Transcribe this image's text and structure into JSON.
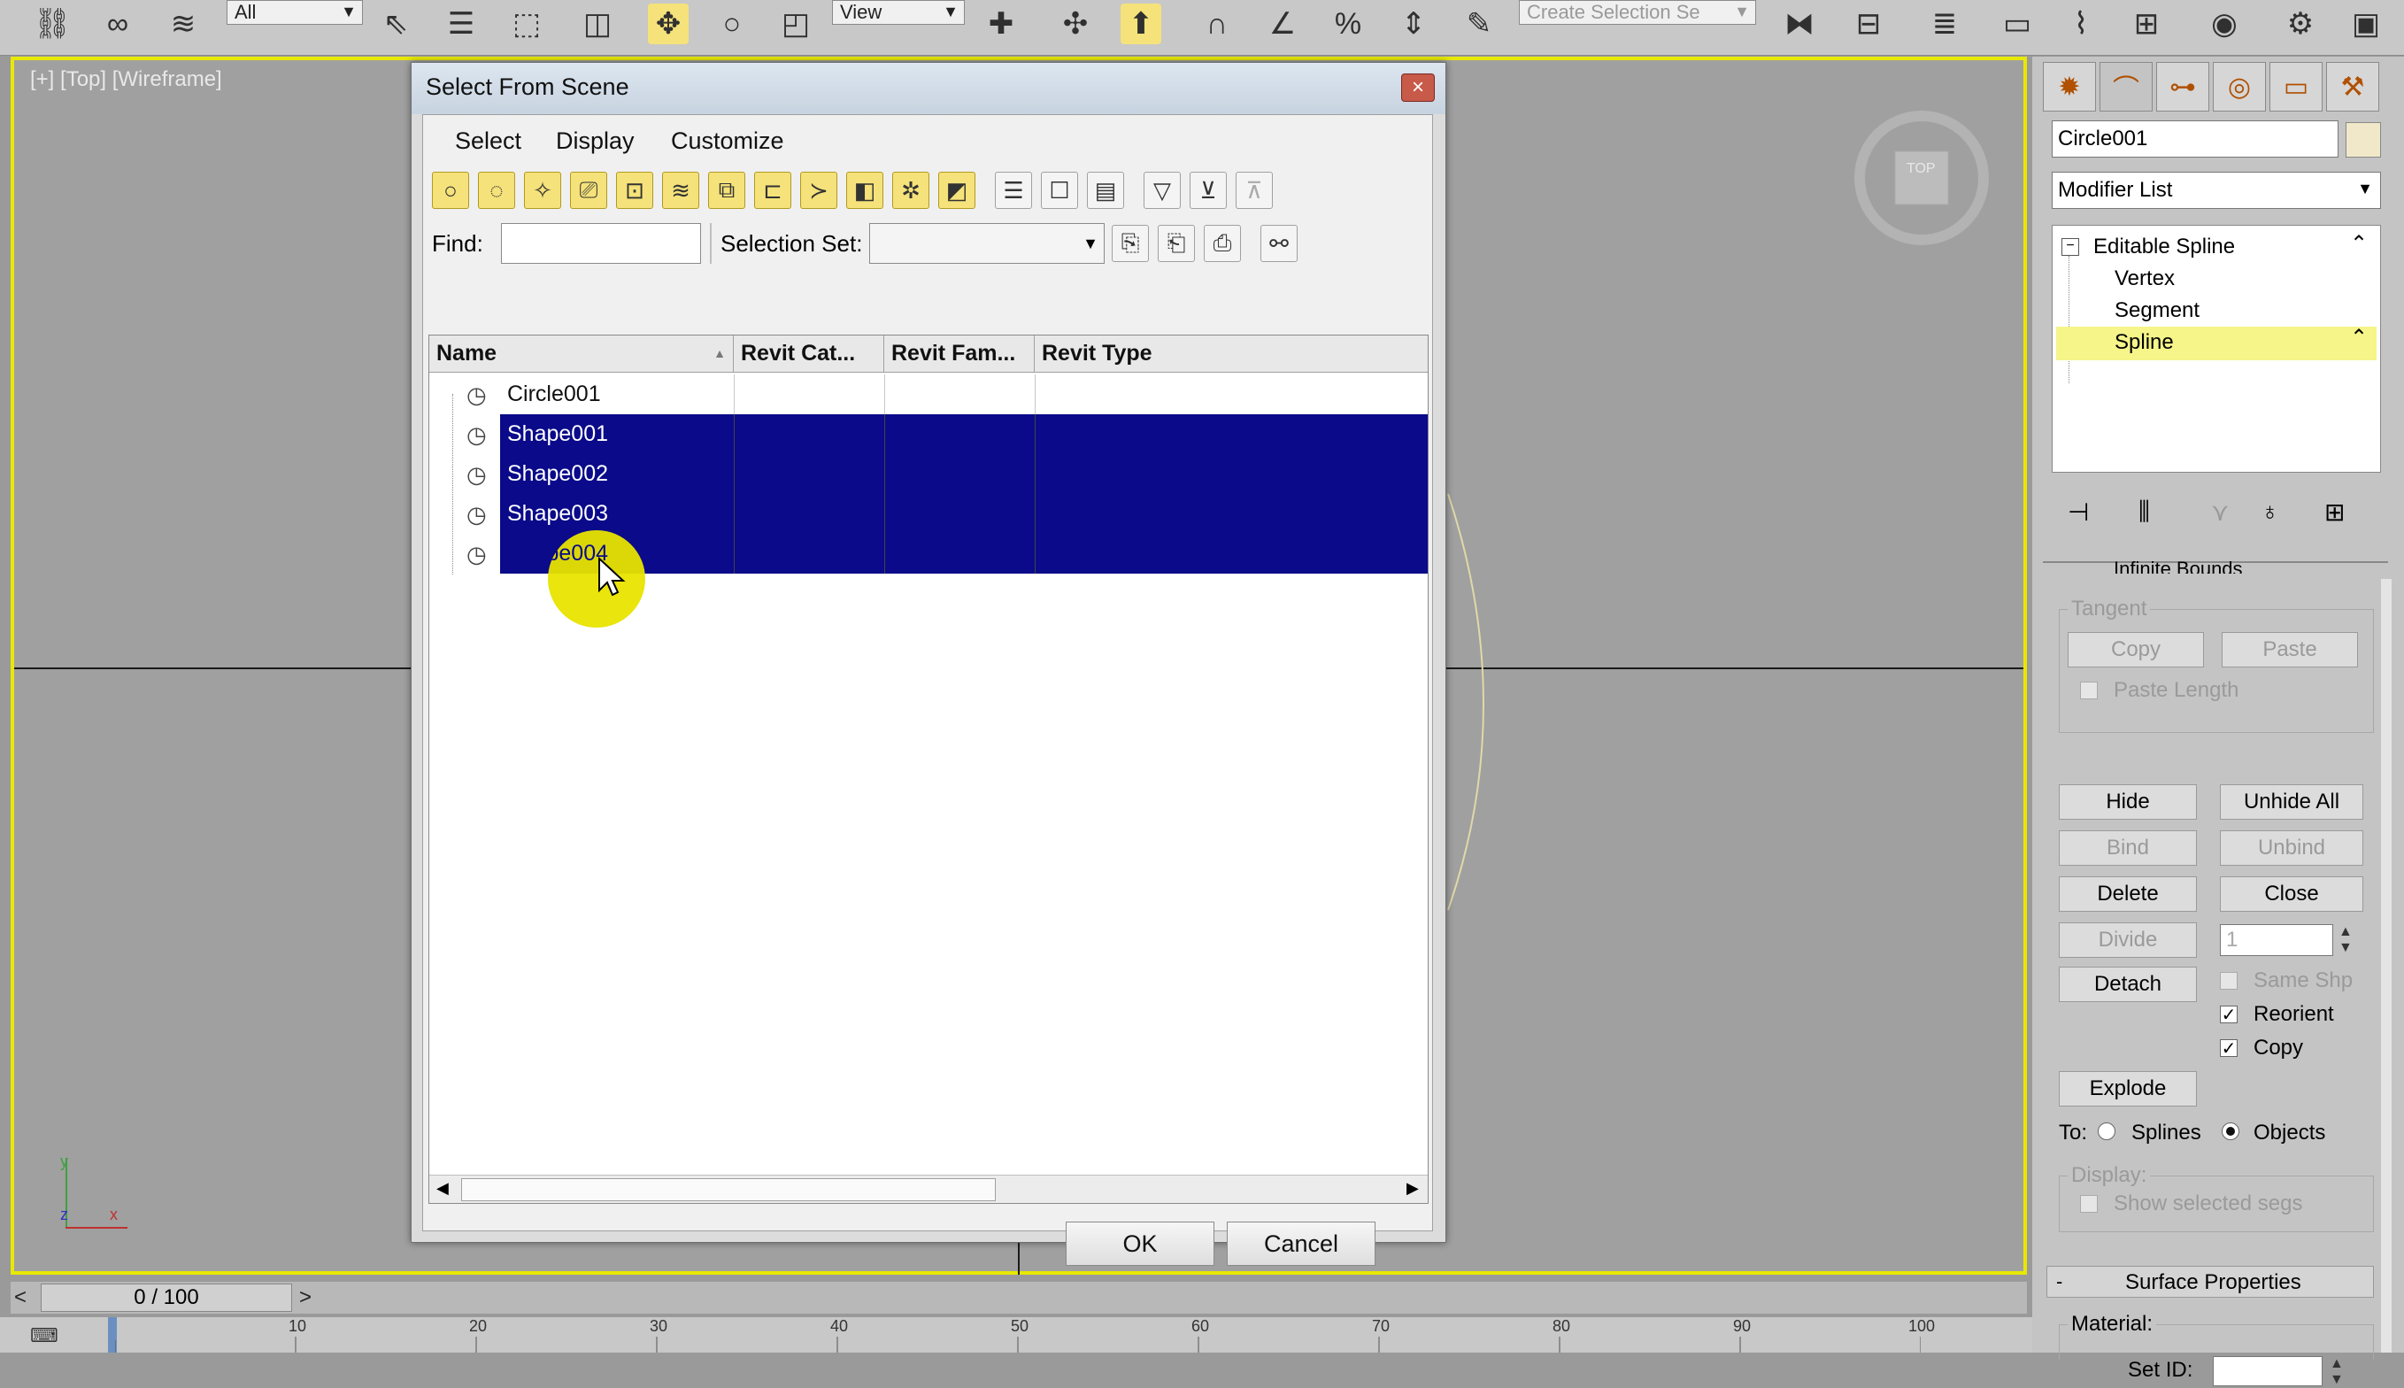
{
  "toolbar": {
    "filter_value": "All",
    "reference_coord_value": "View",
    "named_selection_placeholder": "Create Selection Se"
  },
  "viewport": {
    "label": "[+] [Top] [Wireframe]",
    "viewcube_label": "TOP",
    "axis_y": "y",
    "axis_x": "x",
    "axis_z": "z"
  },
  "timeline": {
    "prev": "<",
    "frame_display": "0 / 100",
    "next": ">"
  },
  "dialog": {
    "title": "Select From Scene",
    "close": "×",
    "menu": [
      "Select",
      "Display",
      "Customize"
    ],
    "find_label": "Find:",
    "find_value": "",
    "selection_set_label": "Selection Set:",
    "selection_set_value": "",
    "columns": [
      "Name",
      "Revit Cat...",
      "Revit Fam...",
      "Revit Type"
    ],
    "sort_indicator": "▲",
    "rows": [
      {
        "name": "Circle001",
        "selected": false
      },
      {
        "name": "Shape001",
        "selected": true
      },
      {
        "name": "Shape002",
        "selected": true
      },
      {
        "name": "Shape003",
        "selected": true
      },
      {
        "name": "Shape004",
        "selected": true
      }
    ],
    "ok_label": "OK",
    "cancel_label": "Cancel"
  },
  "command_panel": {
    "object_name": "Circle001",
    "modifier_list_label": "Modifier List",
    "stack": {
      "root": "Editable Spline",
      "subs": [
        "Vertex",
        "Segment",
        "Spline"
      ],
      "active": "Spline"
    },
    "infinite_bounds_label": "Infinite Bounds",
    "tangent_group": "Tangent",
    "copy_label": "Copy",
    "paste_label": "Paste",
    "paste_length_label": "Paste Length",
    "hide_label": "Hide",
    "unhide_all_label": "Unhide All",
    "bind_label": "Bind",
    "unbind_label": "Unbind",
    "delete_label": "Delete",
    "close_label": "Close",
    "divide_label": "Divide",
    "divide_value": "1",
    "same_shp_label": "Same Shp",
    "detach_label": "Detach",
    "reorient_label": "Reorient",
    "copy_cb_label": "Copy",
    "explode_label": "Explode",
    "to_label": "To:",
    "splines_label": "Splines",
    "objects_label": "Objects",
    "display_group": "Display:",
    "show_selected_segs_label": "Show selected segs",
    "surface_properties_label": "Surface Properties",
    "surface_collapse": "-",
    "material_label": "Material:",
    "set_id_label": "Set ID:",
    "set_id_value": ""
  },
  "ruler_ticks": [
    "10",
    "20",
    "30",
    "40",
    "50",
    "60",
    "70",
    "80",
    "90",
    "100"
  ],
  "colors": {
    "selection_bg": "#0a0a8a",
    "viewport_border": "#e8e800",
    "stack_highlight": "#f5f58a"
  }
}
